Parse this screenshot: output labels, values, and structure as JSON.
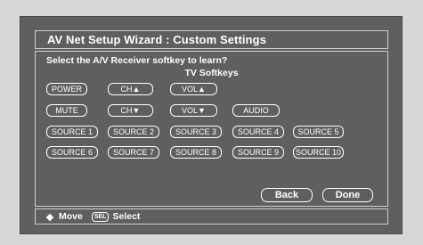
{
  "window": {
    "title": "AV Net Setup Wizard : Custom Settings"
  },
  "prompt": "Select the A/V Receiver softkey to learn?",
  "group_title": "TV Softkeys",
  "softkeys": {
    "power": "POWER",
    "ch_up": "CH▲",
    "vol_up": "VOL▲",
    "mute": "MUTE",
    "ch_down": "CH▼",
    "vol_down": "VOL▼",
    "audio": "AUDIO",
    "source1": "SOURCE 1",
    "source2": "SOURCE 2",
    "source3": "SOURCE 3",
    "source4": "SOURCE 4",
    "source5": "SOURCE 5",
    "source6": "SOURCE 6",
    "source7": "SOURCE 7",
    "source8": "SOURCE 8",
    "source9": "SOURCE 9",
    "source10": "SOURCE 10"
  },
  "actions": {
    "back": "Back",
    "done": "Done"
  },
  "footer": {
    "move_icon": "◆",
    "move_label": "Move",
    "sel_icon": "SEL",
    "sel_label": "Select"
  }
}
